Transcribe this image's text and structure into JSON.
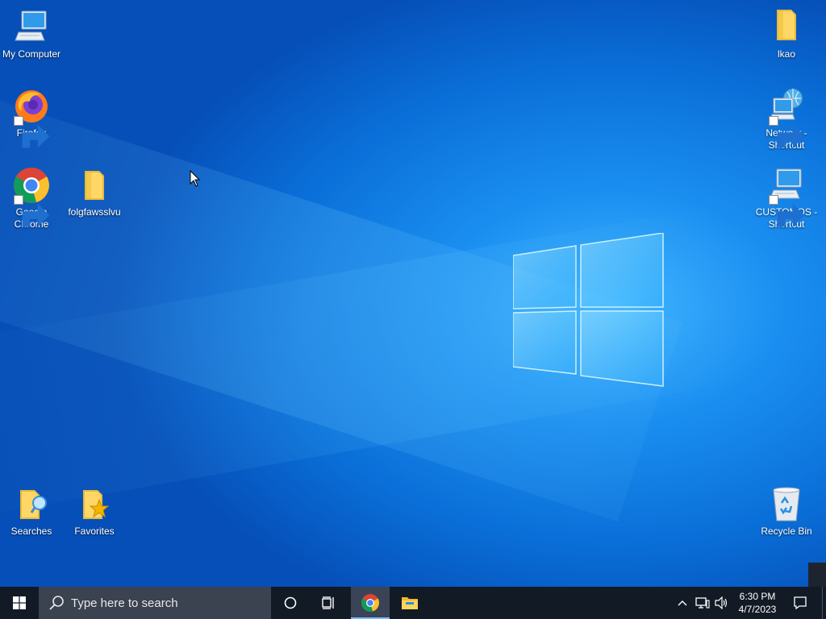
{
  "desktop": {
    "icons_left": [
      {
        "label": "My Computer",
        "icon": "computer-icon"
      },
      {
        "label": "Firefox",
        "icon": "firefox-icon",
        "shortcut": true
      },
      {
        "label": "Google Chrome",
        "icon": "chrome-icon",
        "shortcut": true
      },
      {
        "label": "folgfawsslvu",
        "icon": "folder-icon"
      },
      {
        "label": "Searches",
        "icon": "searches-folder-icon"
      },
      {
        "label": "Favorites",
        "icon": "favorites-folder-icon"
      }
    ],
    "icons_right": [
      {
        "label": "lkao",
        "icon": "folder-icon"
      },
      {
        "label": "Network - Shortcut",
        "icon": "network-icon",
        "shortcut": true
      },
      {
        "label": "CUSTOMOS - Shortcut",
        "icon": "computer-icon",
        "shortcut": true
      },
      {
        "label": "Recycle Bin",
        "icon": "recycle-bin-icon"
      }
    ]
  },
  "taskbar": {
    "start_icon": "windows-start-icon",
    "search_placeholder": "Type here to search",
    "cortana_icon": "cortana-circle-icon",
    "task_view_icon": "task-view-icon",
    "pinned_apps": [
      {
        "name": "Google Chrome",
        "icon": "chrome-icon",
        "active": true
      },
      {
        "name": "File Explorer",
        "icon": "file-explorer-icon",
        "active": false
      }
    ],
    "tray": {
      "chevron_icon": "chevron-up-icon",
      "network_icon": "network-tray-icon",
      "volume_icon": "volume-icon",
      "time": "6:30 PM",
      "date": "4/7/2023",
      "notification_icon": "action-center-icon"
    }
  },
  "colors": {
    "desktop_blue": "#0a6fd8",
    "taskbar": "#121a26",
    "search_box": "#3b4250"
  }
}
